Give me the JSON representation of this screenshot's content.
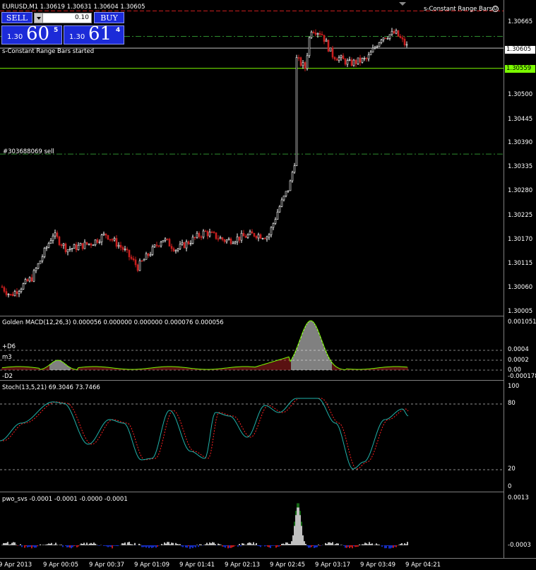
{
  "main": {
    "title": "EURUSD,M1  1.30619 1.30631 1.30604 1.30605",
    "indicator_name": "s-Constant Range Bars",
    "started_text": "s-Constant Range Bars started",
    "order_label": "#303688069 sell",
    "bid_tag": "1.30605",
    "line_tag": "1.30559",
    "price_axis": [
      "1.30665",
      "1.30605",
      "1.30559",
      "1.30500",
      "1.30445",
      "1.30390",
      "1.30335",
      "1.30280",
      "1.30225",
      "1.30170",
      "1.30115",
      "1.30060",
      "1.30005"
    ]
  },
  "trade_panel": {
    "sell_label": "SELL",
    "buy_label": "BUY",
    "lot_value": "0.10",
    "sell_small": "1.30",
    "sell_big": "60",
    "sell_sup": "5",
    "buy_small": "1.30",
    "buy_big": "61",
    "buy_sup": "4"
  },
  "macd": {
    "title": "Golden MACD(12,26,3) 0.000056 0.000000 0.000000 0.000076 0.000056",
    "level_d6": "+D6",
    "level_m3": "m3",
    "level_d2": "-D2",
    "axis": [
      "0.001051",
      "0.0004",
      "0.0002",
      "0.00",
      "-0.000178"
    ]
  },
  "stoch": {
    "title": "Stoch(13,5,21) 69.3046 73.7466",
    "axis": [
      "100",
      "80",
      "20",
      "0"
    ]
  },
  "pwo": {
    "title": "pwo_svs -0.0001 -0.0001 -0.0000 -0.0001",
    "axis": [
      "0.0013",
      "-0.0003"
    ]
  },
  "time_axis": [
    "9 Apr 2013",
    "9 Apr 00:05",
    "9 Apr 00:37",
    "9 Apr 01:09",
    "9 Apr 01:41",
    "9 Apr 02:13",
    "9 Apr 02:45",
    "9 Apr 03:17",
    "9 Apr 03:49",
    "9 Apr 04:21"
  ],
  "colors": {
    "bull_candle": "#ffffff",
    "bear_candle": "#c81e1e",
    "bid_line": "#c0c0c0",
    "green_line": "#7cfc00",
    "ask_dash": "#c81e1e",
    "stoch_main": "#20b2aa",
    "stoch_signal": "#ff2020"
  }
}
